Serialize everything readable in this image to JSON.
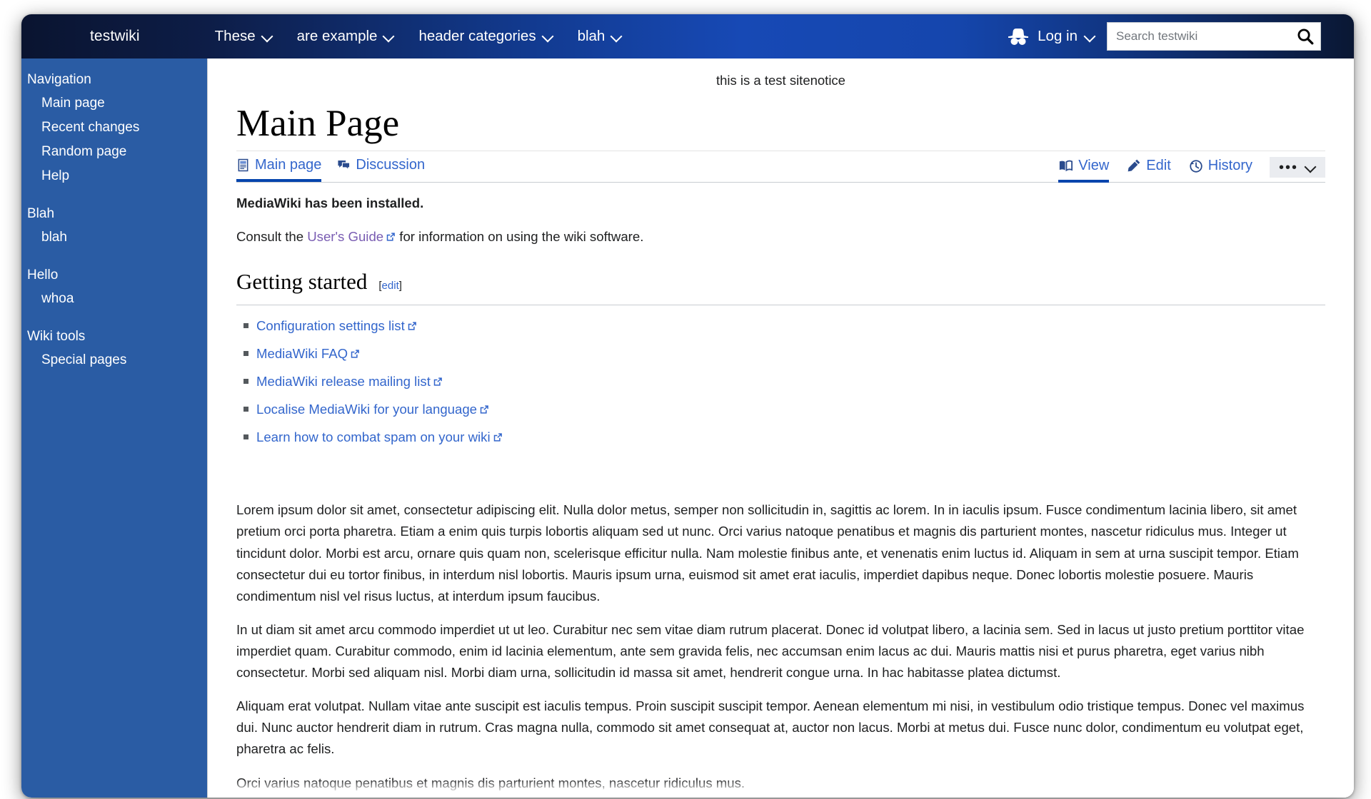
{
  "header": {
    "wiki_name": "testwiki",
    "nav_items": [
      {
        "label": "These",
        "icon": "chevron-down-icon"
      },
      {
        "label": "are example",
        "icon": "chevron-down-icon"
      },
      {
        "label": "header categories",
        "icon": "chevron-down-icon"
      },
      {
        "label": "blah",
        "icon": "chevron-down-icon"
      }
    ],
    "login": {
      "label": "Log in",
      "icon": "anon-user-icon",
      "chevron": "chevron-down-icon"
    },
    "search": {
      "placeholder": "Search testwiki",
      "value": "",
      "button_icon": "search-icon"
    }
  },
  "sidebar": {
    "portals": [
      {
        "heading": "Navigation",
        "links": [
          "Main page",
          "Recent changes",
          "Random page",
          "Help"
        ]
      },
      {
        "heading": "Blah",
        "links": [
          "blah"
        ]
      },
      {
        "heading": "Hello",
        "links": [
          "whoa"
        ]
      },
      {
        "heading": "Wiki tools",
        "links": [
          "Special pages"
        ]
      }
    ]
  },
  "main": {
    "sitenotice": "this is a test sitenotice",
    "page_title": "Main Page",
    "namespace_tabs": [
      {
        "label": "Main page",
        "icon": "article-page-icon",
        "selected": true
      },
      {
        "label": "Discussion",
        "icon": "talk-bubbles-icon",
        "selected": false
      }
    ],
    "view_tabs": [
      {
        "label": "View",
        "icon": "book-open-icon",
        "selected": true
      },
      {
        "label": "Edit",
        "icon": "pencil-icon",
        "selected": false
      },
      {
        "label": "History",
        "icon": "clock-history-icon",
        "selected": false
      }
    ],
    "more_menu": {
      "dots": "•••",
      "chevron": "chevron-down-icon"
    },
    "intro_bold": "MediaWiki has been installed.",
    "consult": {
      "before": "Consult the ",
      "link": "User's Guide",
      "after": " for information on using the wiki software."
    },
    "section": {
      "heading": "Getting started",
      "edit_open": "[",
      "edit_label": "edit",
      "edit_close": "]"
    },
    "getting_started_links": [
      "Configuration settings list",
      "MediaWiki FAQ",
      "MediaWiki release mailing list",
      "Localise MediaWiki for your language",
      "Learn how to combat spam on your wiki"
    ],
    "paragraphs": [
      "Lorem ipsum dolor sit amet, consectetur adipiscing elit. Nulla dolor metus, semper non sollicitudin in, sagittis ac lorem. In in iaculis ipsum. Fusce condimentum lacinia libero, sit amet pretium orci porta pharetra. Etiam a enim quis turpis lobortis aliquam sed ut nunc. Orci varius natoque penatibus et magnis dis parturient montes, nascetur ridiculus mus. Integer ut tincidunt dolor. Morbi est arcu, ornare quis quam non, scelerisque efficitur nulla. Nam molestie finibus ante, et venenatis enim luctus id. Aliquam in sem at urna suscipit tempor. Etiam consectetur dui eu tortor finibus, in interdum nisl lobortis. Mauris ipsum urna, euismod sit amet erat iaculis, imperdiet dapibus neque. Donec lobortis molestie posuere. Mauris condimentum nisl vel risus luctus, at interdum ipsum faucibus.",
      "In ut diam sit amet arcu commodo imperdiet ut ut leo. Curabitur nec sem vitae diam rutrum placerat. Donec id volutpat libero, a lacinia sem. Sed in lacus ut justo pretium porttitor vitae imperdiet quam. Curabitur commodo, enim id lacinia elementum, ante sem gravida felis, nec accumsan enim lacus ac dui. Mauris mattis nisi et purus pharetra, eget varius nibh consectetur. Morbi sed aliquam nisl. Morbi diam urna, sollicitudin id massa sit amet, hendrerit congue urna. In hac habitasse platea dictumst.",
      "Aliquam erat volutpat. Nullam vitae ante suscipit est iaculis tempus. Proin suscipit suscipit tempor. Aenean elementum mi nisi, in vestibulum odio tristique tempus. Donec vel maximus dui. Nunc auctor hendrerit diam in rutrum. Cras magna nulla, commodo sit amet consequat at, auctor non lacus. Morbi at metus dui. Fusce nunc dolor, condimentum eu volutpat eget, pharetra ac felis.",
      "Orci varius natoque penatibus et magnis dis parturient montes, nascetur ridiculus mus."
    ]
  },
  "colors": {
    "header_dark": "#0a1430",
    "header_bright": "#1749b5",
    "sidebar_bg": "#2a5ca4",
    "link_blue": "#3366cc",
    "visited_purple": "#795cb2",
    "tab_underline": "#0645ad"
  }
}
